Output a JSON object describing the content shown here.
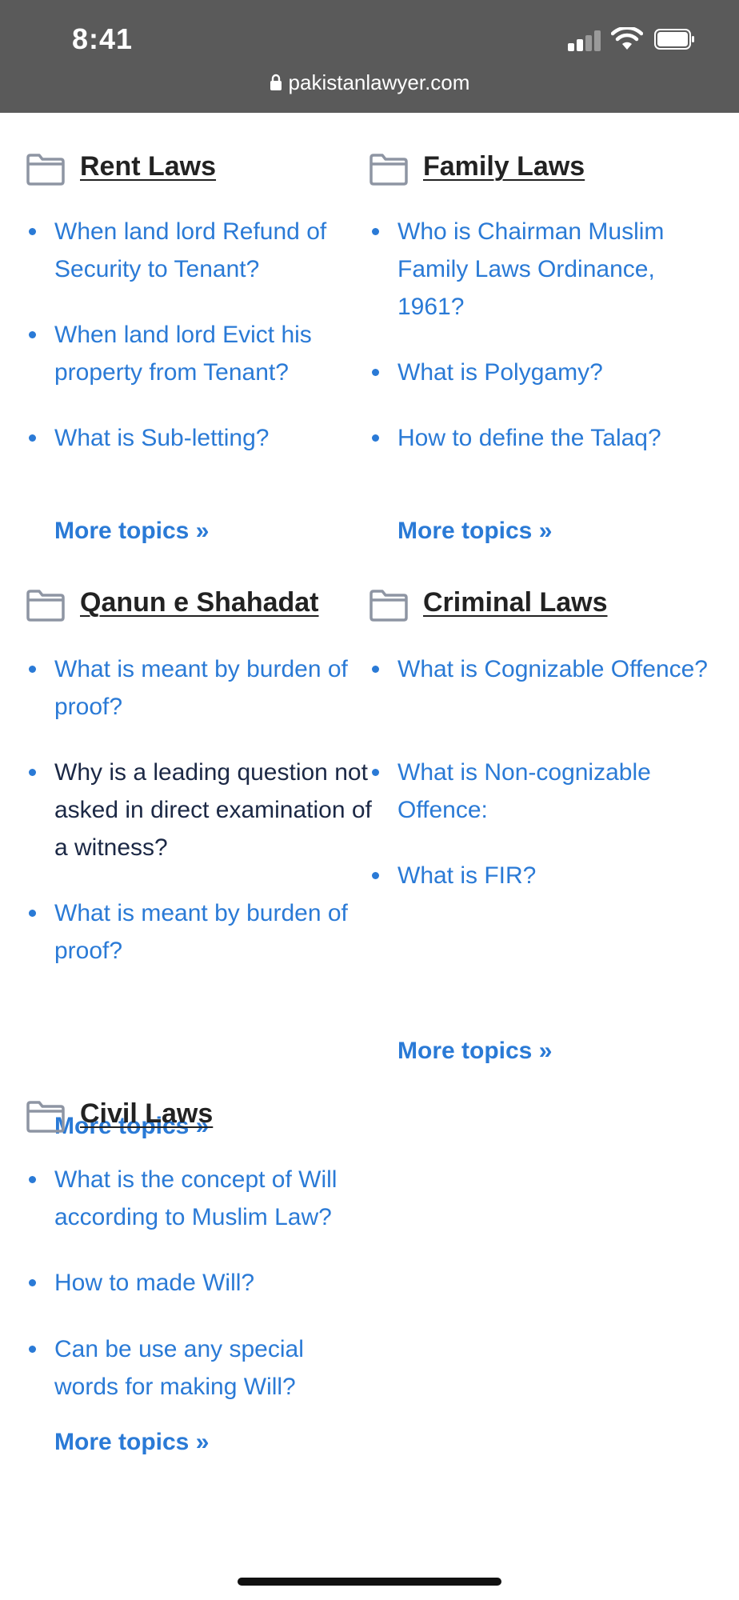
{
  "status": {
    "time": "8:41",
    "url": "pakistanlawyer.com"
  },
  "icons": {
    "folder": "folder-icon",
    "lock": "lock-icon",
    "signal": "cellular-signal-icon",
    "wifi": "wifi-icon",
    "battery": "battery-icon"
  },
  "colors": {
    "link": "#2a7ad6",
    "heading": "#222222",
    "status_bar": "#5a5a5a"
  },
  "categories": [
    {
      "title": "Rent Laws",
      "topics": [
        "When land lord Refund of Security to Tenant?",
        "When land lord Evict his property from Tenant?",
        "What is Sub-letting?"
      ],
      "more": "More topics »"
    },
    {
      "title": "Family Laws",
      "topics": [
        "Who is Chairman Muslim Family Laws Ordinance, 1961?",
        "What is Polygamy?",
        "How to define the Talaq?"
      ],
      "more": "More topics »"
    },
    {
      "title": "Qanun e Shahadat",
      "topics": [
        "What is meant by burden of proof?",
        "Why is a leading question not asked in direct examination of a witness?",
        "What is meant by burden of proof?"
      ],
      "more": "More topics »"
    },
    {
      "title": "Criminal Laws",
      "topics": [
        "What is Cognizable Offence?",
        "What is Non-cognizable Offence:",
        "What is FIR?"
      ],
      "more": "More topics »"
    },
    {
      "title": "Civil Laws",
      "topics": [
        "What is the concept of Will according to Muslim Law?",
        "How to made Will?",
        "Can be use any special words for making Will?"
      ],
      "more": "More topics »"
    }
  ]
}
